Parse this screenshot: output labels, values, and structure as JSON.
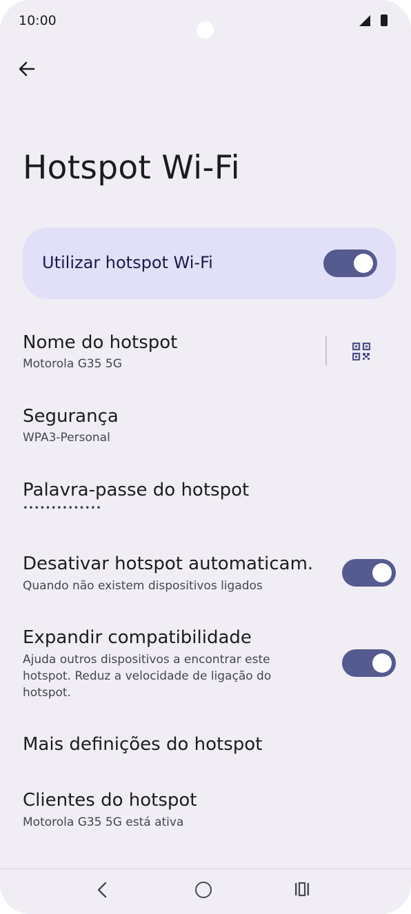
{
  "status_bar": {
    "time": "10:00"
  },
  "header": {
    "title": "Hotspot Wi-Fi"
  },
  "main_switch": {
    "label": "Utilizar hotspot Wi-Fi",
    "on": true
  },
  "items": [
    {
      "title": "Nome do hotspot",
      "subtitle": "Motorola G35 5G"
    },
    {
      "title": "Segurança",
      "subtitle": "WPA3-Personal"
    },
    {
      "title": "Palavra-passe do hotspot",
      "subtitle": "••••••••••••••"
    },
    {
      "title": "Desativar hotspot automaticam.",
      "subtitle": "Quando não existem dispositivos ligados",
      "toggle_on": true
    },
    {
      "title": "Expandir compatibilidade",
      "subtitle": "Ajuda outros dispositivos a encontrar este hotspot. Reduz a velocidade de ligação do hotspot.",
      "toggle_on": true
    },
    {
      "title": "Mais definições do hotspot"
    },
    {
      "title": "Clientes do hotspot",
      "subtitle": "Motorola G35 5G está ativa"
    }
  ],
  "icons": {
    "back": "back-arrow-icon",
    "qr": "qr-code-icon",
    "signal": "signal-icon",
    "battery": "battery-icon",
    "nav_back": "nav-back-icon",
    "nav_home": "nav-home-icon",
    "nav_recents": "nav-recents-icon"
  },
  "colors": {
    "background": "#f1edf5",
    "card": "#e1e0f8",
    "toggle_track": "#555a8f",
    "text": "#1c1b1f"
  }
}
